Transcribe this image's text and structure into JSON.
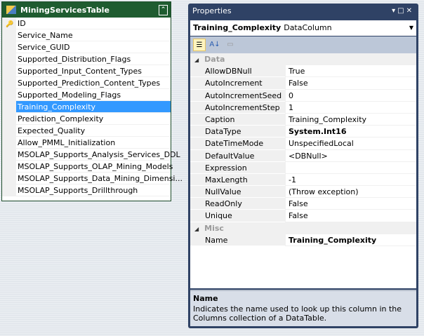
{
  "table": {
    "title": "MiningServicesTable",
    "columns": [
      "ID",
      "Service_Name",
      "Service_GUID",
      "Supported_Distribution_Flags",
      "Supported_Input_Content_Types",
      "Supported_Prediction_Content_Types",
      "Supported_Modeling_Flags",
      "Training_Complexity",
      "Prediction_Complexity",
      "Expected_Quality",
      "Allow_PMML_Initialization",
      "MSOLAP_Supports_Analysis_Services_DDL",
      "MSOLAP_Supports_OLAP_Mining_Models",
      "MSOLAP_Supports_Data_Mining_Dimensi...",
      "MSOLAP_Supports_Drillthrough"
    ],
    "selected": "Training_Complexity",
    "key_column": "ID"
  },
  "properties": {
    "title": "Properties",
    "object_name": "Training_Complexity",
    "object_type": "DataColumn",
    "categories": [
      {
        "name": "Data",
        "items": [
          [
            "AllowDBNull",
            "True"
          ],
          [
            "AutoIncrement",
            "False"
          ],
          [
            "AutoIncrementSeed",
            "0"
          ],
          [
            "AutoIncrementStep",
            "1"
          ],
          [
            "Caption",
            "Training_Complexity"
          ],
          [
            "DataType",
            "System.Int16"
          ],
          [
            "DateTimeMode",
            "UnspecifiedLocal"
          ],
          [
            "DefaultValue",
            "<DBNull>"
          ],
          [
            "Expression",
            ""
          ],
          [
            "MaxLength",
            "-1"
          ],
          [
            "NullValue",
            "(Throw exception)"
          ],
          [
            "ReadOnly",
            "False"
          ],
          [
            "Unique",
            "False"
          ]
        ]
      },
      {
        "name": "Misc",
        "items": [
          [
            "Name",
            "Training_Complexity"
          ]
        ]
      }
    ],
    "bold_values": [
      "DataType",
      "Name"
    ],
    "description_title": "Name",
    "description_text": "Indicates the name used to look up this column in the Columns collection of a DataTable."
  },
  "colors": {
    "table_header": "#1f5c30",
    "selection": "#3399ff",
    "window_frame": "#2f4265"
  }
}
